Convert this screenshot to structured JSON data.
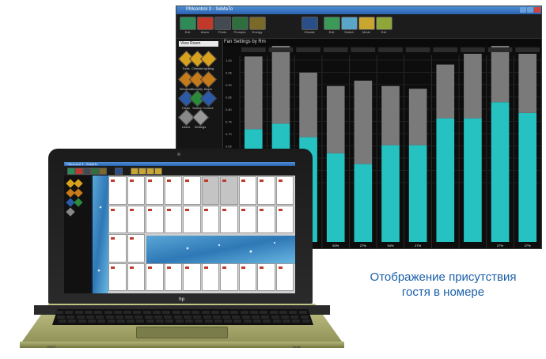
{
  "monitor": {
    "window_title": "PMcontrol 3 - SeMaTo",
    "toolbar": [
      {
        "label": "Exit",
        "color": "#2e8b57"
      },
      {
        "label": "Alarm",
        "color": "#c0392b"
      },
      {
        "label": "Prints",
        "color": "#444a52"
      },
      {
        "label": "Prompts",
        "color": "#2f6f3f"
      },
      {
        "label": "Energy",
        "color": "#7a6a2a"
      },
      {
        "label": "Climate",
        "color": "#2a4f88"
      },
      {
        "label": "Exit",
        "color": "#3b9a5a"
      },
      {
        "label": "Switch",
        "color": "#5aa6c8"
      },
      {
        "label": "Mode",
        "color": "#c8a630"
      },
      {
        "label": "Exit",
        "color": "#8fa63b"
      }
    ],
    "dropdown": "View Room",
    "menu": [
      {
        "label": "Tools",
        "color": "#d9a21e"
      },
      {
        "label": "Climate",
        "color": "#d9a21e"
      },
      {
        "label": "Lighting",
        "color": "#d9a21e"
      },
      {
        "label": "Windows",
        "color": "#c77a1a"
      },
      {
        "label": "Security",
        "color": "#c77a1a"
      },
      {
        "label": "Alarm",
        "color": "#c77a1a"
      },
      {
        "label": "Clean",
        "color": "#2a5aa8"
      },
      {
        "label": "Switch",
        "color": "#2a8a3a"
      },
      {
        "label": "Control",
        "color": "#2a5aa8"
      },
      {
        "label": "Users",
        "color": "#888888"
      },
      {
        "label": "Settings",
        "color": "#999999"
      }
    ],
    "chart_title": "Fan Settings by Rm",
    "legend": "Fan"
  },
  "chart_data": {
    "type": "bar",
    "categories": [
      "1",
      "2",
      "3",
      "4",
      "5",
      "6",
      "7",
      "8",
      "9",
      "10",
      "11"
    ],
    "series": [
      {
        "values": [
          0.42,
          0.44,
          0.39,
          0.33,
          0.29,
          0.36,
          0.36,
          0.46,
          0.46,
          0.52,
          0.48
        ],
        "color": "#26c2c2"
      },
      {
        "values": [
          0.27,
          0.29,
          0.24,
          0.25,
          0.31,
          0.22,
          0.21,
          0.2,
          0.24,
          0.27,
          0.22
        ],
        "color": "#7a7a7a"
      }
    ],
    "ylim": [
      0,
      1.0
    ],
    "yticks": [
      "1.00",
      "0.95",
      "0.90",
      "0.85",
      "0.80",
      "0.75",
      "0.70",
      "0.65",
      "0.60",
      "0.55",
      "0.50"
    ],
    "bottom_labels": [
      "",
      "",
      "",
      "52%",
      "27%",
      "54%",
      "27%",
      "",
      "",
      "27%",
      "27%"
    ],
    "grid": true
  },
  "laptop": {
    "screen_title": "PMcontrol 3 - SeMaTo",
    "brand": "hp",
    "front_left": "ENVY",
    "front_right": "beats"
  },
  "caption": {
    "line1": "Отображение присутствия",
    "line2": "гостя в номере"
  }
}
